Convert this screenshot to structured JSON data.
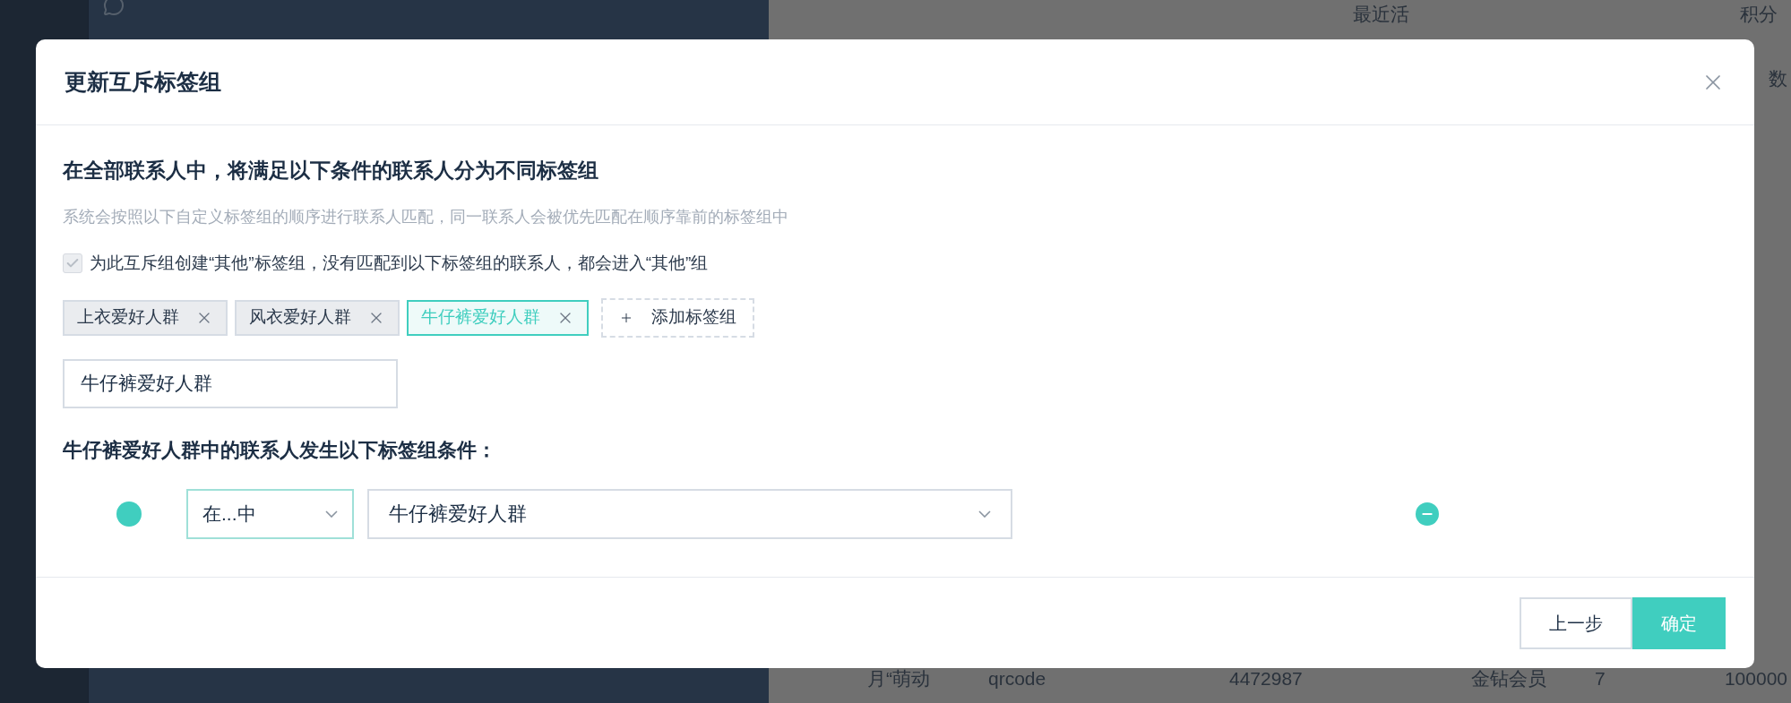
{
  "background": {
    "table_columns": [
      {},
      {
        "cells": [
          "月“萌动"
        ]
      },
      {
        "cells": [
          "qrcode"
        ]
      },
      {},
      {
        "cells": [
          "4472987"
        ]
      },
      {
        "header": [
          "最近活"
        ]
      },
      {
        "cells": [
          "金钻会员"
        ]
      },
      {
        "cells": [
          "7"
        ]
      },
      {
        "header": [
          "积分",
          "数"
        ],
        "cells": [
          "100000"
        ]
      }
    ]
  },
  "dialog": {
    "title": "更新互斥标签组",
    "heading": "在全部联系人中，将满足以下条件的联系人分为不同标签组",
    "description": "系统会按照以下自定义标签组的顺序进行联系人匹配，同一联系人会被优先匹配在顺序靠前的标签组中",
    "other_group_checkbox": {
      "label": "为此互斥组创建“其他”标签组，没有匹配到以下标签组的联系人，都会进入“其他”组",
      "checked": true,
      "disabled": true
    },
    "tag_groups": [
      {
        "label": "上衣爱好人群",
        "selected": false
      },
      {
        "label": "风衣爱好人群",
        "selected": false
      },
      {
        "label": "牛仔裤爱好人群",
        "selected": true
      }
    ],
    "add_button": "添加标签组",
    "name_input": {
      "value": "牛仔裤爱好人群"
    },
    "condition_heading": "牛仔裤爱好人群中的联系人发生以下标签组条件：",
    "conditions": [
      {
        "operator": "在...中",
        "value": "牛仔裤爱好人群"
      }
    ],
    "buttons": [
      {
        "label": "上一步",
        "kind": "secondary"
      },
      {
        "label": "确定",
        "kind": "primary"
      }
    ]
  }
}
